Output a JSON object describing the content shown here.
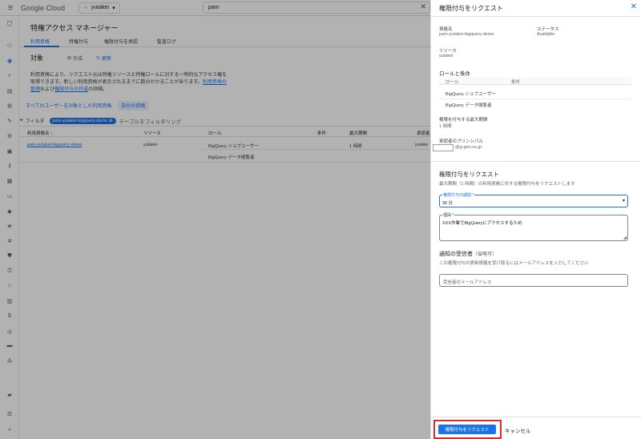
{
  "topbar": {
    "logo_text": "Google Cloud",
    "project": "yutakei",
    "search_value": "pam"
  },
  "main": {
    "page_title": "特権アクセス マネージャー",
    "tabs": [
      "利用資格",
      "特権付与",
      "権限付与を承認",
      "監査ログ"
    ],
    "section_title": "対象",
    "actions": {
      "create": "作成",
      "refresh": "更新"
    },
    "description_part1": "利用資格により、リクエスト元は特権リソースと特権ロールに対する一時的なアクセス権を取得できます。新しい利用資格が表示されるまでに数分かかることがあります。",
    "description_link1": "利用資格の管理",
    "description_part2": "および",
    "description_link2": "権限付与の作成",
    "description_part3": "の詳細。",
    "subtabs": [
      "すべてのユーザーを対象とした利用資格",
      "自分の資格"
    ],
    "filter": {
      "label": "フィルタ",
      "chip": "pam-yutakei-bigquery-demo",
      "placeholder": "テーブルをフィルタリング"
    },
    "table": {
      "headers": [
        "利用資格名",
        "リソース",
        "ロール",
        "条件",
        "最大期間",
        "承認者"
      ],
      "sort_indicator": "↑",
      "rows": [
        {
          "name": "pam-yutakei-bigquery-demo",
          "resource": "yutakei",
          "roles": [
            "BigQuery ジョブユーザー",
            "BigQuery データ閲覧者"
          ],
          "duration": "1 時間",
          "approver": "yutake"
        }
      ]
    }
  },
  "panel": {
    "title": "権限付与をリクエスト",
    "eligibility_label": "資格名",
    "eligibility_value": "pam-yutakei-bigquery-demo",
    "status_label": "ステータス",
    "status_value": "Available",
    "resource_label": "リソース",
    "resource_value": "yutakei",
    "roles_heading": "ロールと条件",
    "roles_header": [
      "ロール",
      "条件"
    ],
    "roles": [
      "BigQuery ジョブユーザー",
      "BigQuery データ閲覧者"
    ],
    "max_duration_label": "権限を付与する最大期間",
    "max_duration_value": "1 時間",
    "approver_label": "承認者のプリンシパル",
    "approver_value": "@g-gen.co.jp",
    "request_heading": "権限付与をリクエスト",
    "request_desc": "最大期間（1 時間）の利用資格に対する権限付与をリクエストします",
    "duration_field_label": "権限付与の期間 *",
    "duration_field_value": "30 分",
    "reason_label": "理由 *",
    "reason_value": "XXX作業でBigQueryにアクセスするため",
    "notify_heading": "通知の受信者",
    "notify_optional": "（省略可）",
    "notify_desc": "この権限付与の更新情報を受け取るにはメールアドレスを入力してください",
    "email_placeholder": "受信者のメールアドレス",
    "submit_label": "権限付与をリクエスト",
    "cancel_label": "キャンセル"
  }
}
